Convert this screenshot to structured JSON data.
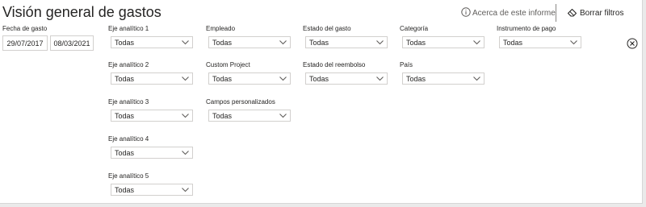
{
  "header": {
    "title": "Visión general de gastos",
    "about_label": "Acerca de este informe",
    "clear_label": "Borrar filtros"
  },
  "date_filter": {
    "label": "Fecha de gasto",
    "start": "29/07/2017",
    "end": "08/03/2021"
  },
  "filters": {
    "eje1": {
      "label": "Eje analítico 1",
      "value": "Todas"
    },
    "eje2": {
      "label": "Eje analítico 2",
      "value": "Todas"
    },
    "eje3": {
      "label": "Eje analítico 3",
      "value": "Todas"
    },
    "eje4": {
      "label": "Eje analítico 4",
      "value": "Todas"
    },
    "eje5": {
      "label": "Eje analítico 5",
      "value": "Todas"
    },
    "empleado": {
      "label": "Empleado",
      "value": "Todas"
    },
    "custom_project": {
      "label": "Custom Project",
      "value": "Todas"
    },
    "campos": {
      "label": "Campos personalizados",
      "value": "Todas"
    },
    "estado_gasto": {
      "label": "Estado del gasto",
      "value": "Todas"
    },
    "estado_reembolso": {
      "label": "Estado del reembolso",
      "value": "Todas"
    },
    "categoria": {
      "label": "Categoría",
      "value": "Todas"
    },
    "pais": {
      "label": "País",
      "value": "Todas"
    },
    "instrumento": {
      "label": "Instrumento de pago",
      "value": "Todas"
    }
  },
  "icons": {
    "info": "info-circle-icon",
    "eraser": "eraser-icon",
    "chevron": "chevron-down-icon",
    "close": "close-circle-icon"
  },
  "colors": {
    "text": "#252423",
    "muted": "#605e5c",
    "border": "#d2d0ce"
  }
}
